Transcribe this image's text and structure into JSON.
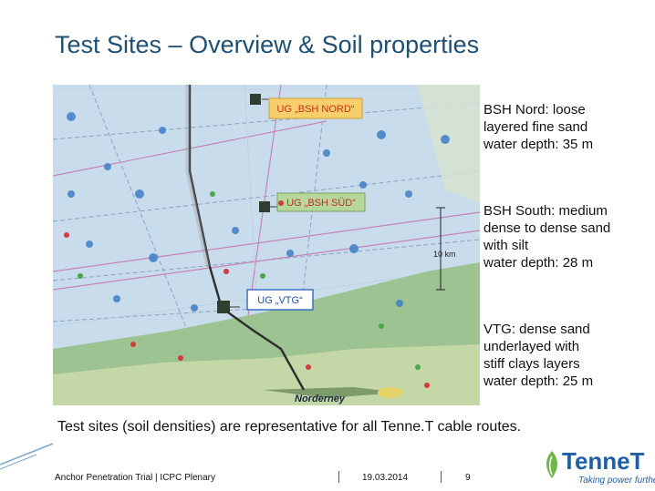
{
  "slide": {
    "title": "Test Sites – Overview & Soil properties",
    "summary": "Test sites (soil densities) are representative for all Tenne.T cable routes."
  },
  "map": {
    "labels": {
      "ug_bsh_nord": "UG „BSH NORD“",
      "ug_bsh_sud": "UG „BSH SÜD“",
      "ug_vtg": "UG „VTG“",
      "norderney": "Norderney",
      "scale": "10 km"
    },
    "colors": {
      "sea": "#c9dcec",
      "land": "#9ec393",
      "label_box": "#f6cf6a"
    }
  },
  "notes": {
    "bsh_nord": {
      "line1": "BSH Nord: loose",
      "line2": "layered fine sand",
      "line3": "water depth: 35 m"
    },
    "bsh_south": {
      "line1": "BSH South: medium",
      "line2": "dense to dense sand",
      "line3": "with silt",
      "line4": "water depth: 28 m"
    },
    "vtg": {
      "line1": "VTG: dense sand",
      "line2": "underlayed with",
      "line3": "stiff  clays layers",
      "line4": "water depth: 25 m"
    }
  },
  "footer": {
    "event": "Anchor Penetration Trial | ICPC Plenary",
    "date": "19.03.2014",
    "page": "9"
  },
  "logo": {
    "name": "TenneT",
    "tagline": "Taking power further"
  }
}
